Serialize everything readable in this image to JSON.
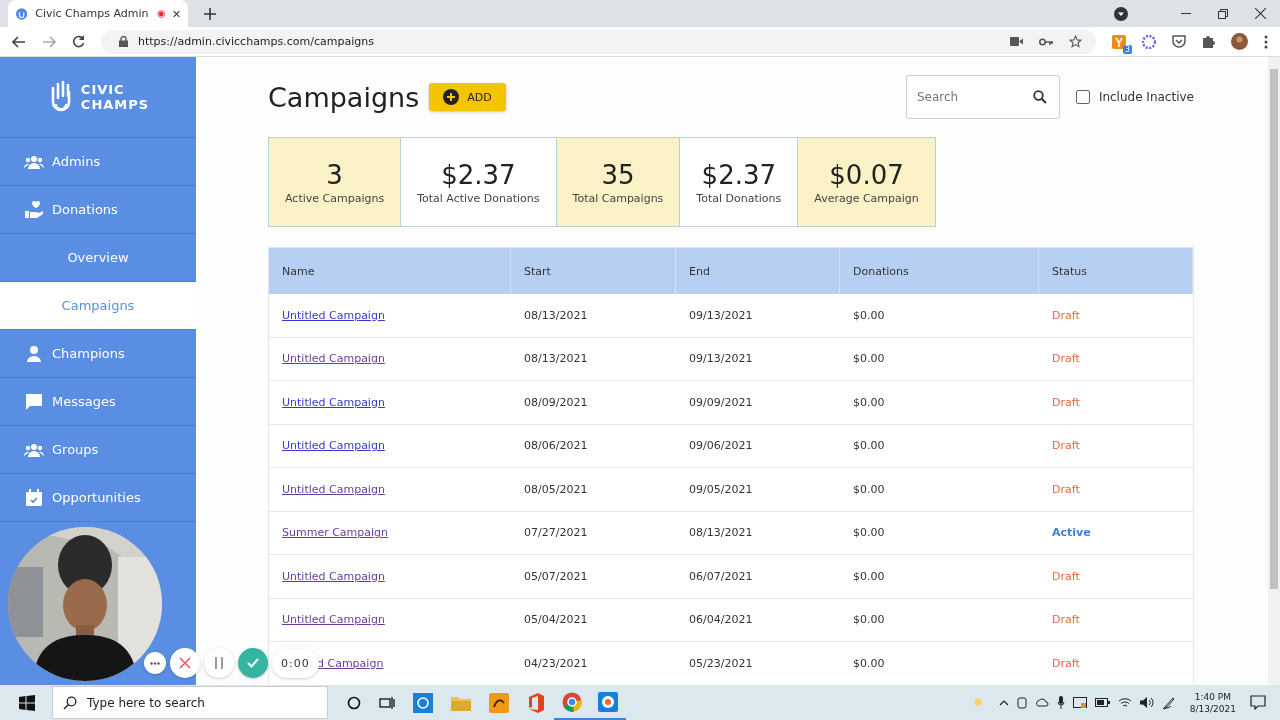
{
  "browser": {
    "tab_title": "Civic Champs Admin",
    "url": "https://admin.civicchamps.com/campaigns",
    "extension_badge": "3"
  },
  "sidebar": {
    "logo_lines": [
      "CIVIC",
      "CHAMPS"
    ],
    "items": [
      {
        "label": "Admins",
        "kind": "people",
        "selected": false
      },
      {
        "label": "Donations",
        "kind": "donate",
        "selected": false
      },
      {
        "label": "Overview",
        "kind": "sub",
        "selected": false
      },
      {
        "label": "Campaigns",
        "kind": "sub",
        "selected": true
      },
      {
        "label": "Champions",
        "kind": "person",
        "selected": false
      },
      {
        "label": "Messages",
        "kind": "message",
        "selected": false
      },
      {
        "label": "Groups",
        "kind": "people",
        "selected": false
      },
      {
        "label": "Opportunities",
        "kind": "calendar",
        "selected": false
      }
    ]
  },
  "page": {
    "title": "Campaigns",
    "add_button": "ADD",
    "search": {
      "placeholder": "Search"
    },
    "include_inactive": {
      "label": "Include Inactive",
      "checked": false
    }
  },
  "stats": [
    {
      "value": "3",
      "label": "Active Campaigns",
      "highlighted": true
    },
    {
      "value": "$2.37",
      "label": "Total Active Donations",
      "highlighted": false
    },
    {
      "value": "35",
      "label": "Total Campaigns",
      "highlighted": true
    },
    {
      "value": "$2.37",
      "label": "Total Donations",
      "highlighted": false
    },
    {
      "value": "$0.07",
      "label": "Average Campaign",
      "highlighted": true
    }
  ],
  "table": {
    "columns": [
      "Name",
      "Start",
      "End",
      "Donations",
      "Status"
    ],
    "rows": [
      {
        "name": "Untitled Campaign",
        "visited": false,
        "start": "08/13/2021",
        "end": "09/13/2021",
        "donations": "$0.00",
        "status": "Draft",
        "kind": "draft"
      },
      {
        "name": "Untitled Campaign",
        "visited": true,
        "start": "08/13/2021",
        "end": "09/13/2021",
        "donations": "$0.00",
        "status": "Draft",
        "kind": "draft"
      },
      {
        "name": "Untitled Campaign",
        "visited": false,
        "start": "08/09/2021",
        "end": "09/09/2021",
        "donations": "$0.00",
        "status": "Draft",
        "kind": "draft"
      },
      {
        "name": "Untitled Campaign",
        "visited": false,
        "start": "08/06/2021",
        "end": "09/06/2021",
        "donations": "$0.00",
        "status": "Draft",
        "kind": "draft"
      },
      {
        "name": "Untitled Campaign",
        "visited": true,
        "start": "08/05/2021",
        "end": "09/05/2021",
        "donations": "$0.00",
        "status": "Draft",
        "kind": "draft"
      },
      {
        "name": "Summer Campaign",
        "visited": true,
        "start": "07/27/2021",
        "end": "08/13/2021",
        "donations": "$0.00",
        "status": "Active",
        "kind": "active"
      },
      {
        "name": "Untitled Campaign",
        "visited": true,
        "start": "05/07/2021",
        "end": "06/07/2021",
        "donations": "$0.00",
        "status": "Draft",
        "kind": "draft"
      },
      {
        "name": "Untitled Campaign",
        "visited": true,
        "start": "05/04/2021",
        "end": "06/04/2021",
        "donations": "$0.00",
        "status": "Draft",
        "kind": "draft"
      },
      {
        "name": "d Campaign",
        "visited": true,
        "covered": true,
        "start": "04/23/2021",
        "end": "05/23/2021",
        "donations": "$0.00",
        "status": "Draft",
        "kind": "draft"
      }
    ]
  },
  "recorder": {
    "timer": "0:00"
  },
  "taskbar": {
    "search_placeholder": "Type here to search",
    "time": "1:40 PM",
    "date": "8/13/2021"
  }
}
